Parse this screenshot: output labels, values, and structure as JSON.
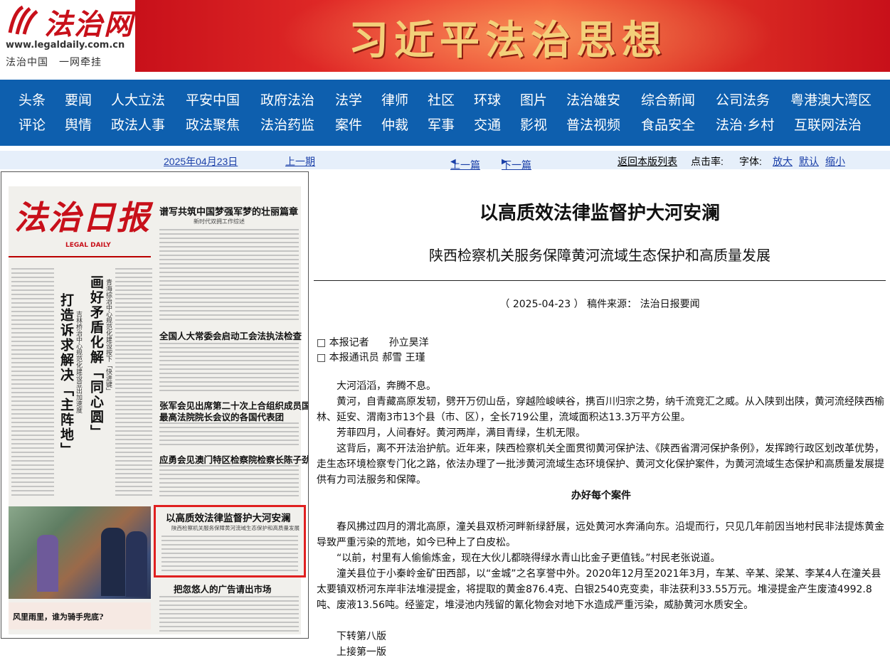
{
  "header": {
    "site_name": "法治网",
    "site_url": "www.legaldaily.com.cn",
    "slogan": "法治中国　一网牵挂",
    "banner_title": "习近平法治思想"
  },
  "nav": {
    "row1": [
      "头条",
      "要闻",
      "人大立法",
      "平安中国",
      "政府法治",
      "法学",
      "律师",
      "社区",
      "环球",
      "图片",
      "法治雄安",
      "综合新闻",
      "公司法务",
      "粤港澳大湾区"
    ],
    "row2": [
      "评论",
      "舆情",
      "政法人事",
      "政法聚焦",
      "法治药监",
      "案件",
      "仲裁",
      "军事",
      "交通",
      "影视",
      "普法视频",
      "食品安全",
      "法治·乡村",
      "互联网法治"
    ]
  },
  "toolbar": {
    "date": "2025年04月23日",
    "prev_issue": "上一期",
    "prev_article": "上一篇",
    "next_article": "下一篇",
    "back_to_list": "返回本版列表",
    "click_rate": "点击率:",
    "font_label": "字体:",
    "font_larger": "放大",
    "font_default": "默认",
    "font_smaller": "缩小"
  },
  "paper_thumb": {
    "masthead": "法治日报",
    "masthead_sub": "LEGAL DAILY",
    "headline_1": "谱写共筑中国梦强军梦的壮丽篇章",
    "headline_1_sub": "新时代双拥工作综述",
    "headline_2": "全国人大常委会启动工会法执法检查",
    "headline_3a": "张军会见出席第二十次上合组织成员国",
    "headline_3b": "最高法院院长会议的各国代表团",
    "headline_4": "应勇会见澳门特区检察院检察长陈子劲",
    "vertical_1": "打造诉求解决「主阵地」",
    "vertical_2": "画好矛盾化解「同心圆」",
    "vertical_sub_1": "吉林桥治中心规范化建设显出加速度",
    "vertical_sub_2": "青海综治中心规范化建设按下「快进键」",
    "boxed_headline": "以高质效法律监督护大河安澜",
    "boxed_sub": "陕西检察机关服务保障黄河流域生态保护和高质量发展",
    "bottom_headline": "把忽悠人的广告请出市场",
    "ad_headline": "风里雨里，谁为骑手兜底?"
  },
  "article": {
    "title": "以高质效法律监督护大河安澜",
    "subtitle": "陕西检察机关服务保障黄河流域生态保护和高质量发展",
    "meta": "（ 2025-04-23 ） 稿件来源： 法治日报要闻",
    "byline_1": "□ 本报记者　　孙立昊洋",
    "byline_2": "□ 本报通讯员 郝雪 王瑾",
    "paragraphs_1": [
      "大河滔滔，奔腾不息。",
      "黄河，自青藏高原发轫，劈开万仞山岳，穿越险峻峡谷，携百川归宗之势，纳千流竞汇之威。从入陕到出陕，黄河流经陕西榆林、延安、渭南3市13个县（市、区），全长719公里，流域面积达13.3万平方公里。",
      "芳菲四月，人间春好。黄河两岸，满目青绿，生机无限。",
      "这背后，离不开法治护航。近年来，陕西检察机关全面贯彻黄河保护法、《陕西省渭河保护条例》，发挥跨行政区划改革优势，走生态环境检察专门化之路，依法办理了一批涉黄河流域生态环境保护、黄河文化保护案件，为黄河流域生态保护和高质量发展提供有力司法服务和保障。"
    ],
    "section_heading": "办好每个案件",
    "paragraphs_2": [
      "春风拂过四月的渭北高原，潼关县双桥河畔新绿舒展，远处黄河水奔涌向东。沿堤而行，只见几年前因当地村民非法提炼黄金导致严重污染的荒地，如今已种上了白皮松。",
      "“以前，村里有人偷偷炼金，现在大伙儿都晓得绿水青山比金子更值钱。”村民老张说道。",
      "潼关县位于小秦岭金矿田西部，以“金城”之名享誉中外。2020年12月至2021年3月，车某、辛某、梁某、李某4人在潼关县太要镇双桥河东岸非法堆浸提金，将提取的黄金876.4克、白银2540克变卖，非法获利33.55万元。堆浸提金产生废渣4992.8吨、废液13.56吨。经鉴定，堆浸池内残留的氰化物会对地下水造成严重污染，威胁黄河水质安全。"
    ],
    "continue_1": "下转第八版",
    "continue_2": "上接第一版"
  }
}
